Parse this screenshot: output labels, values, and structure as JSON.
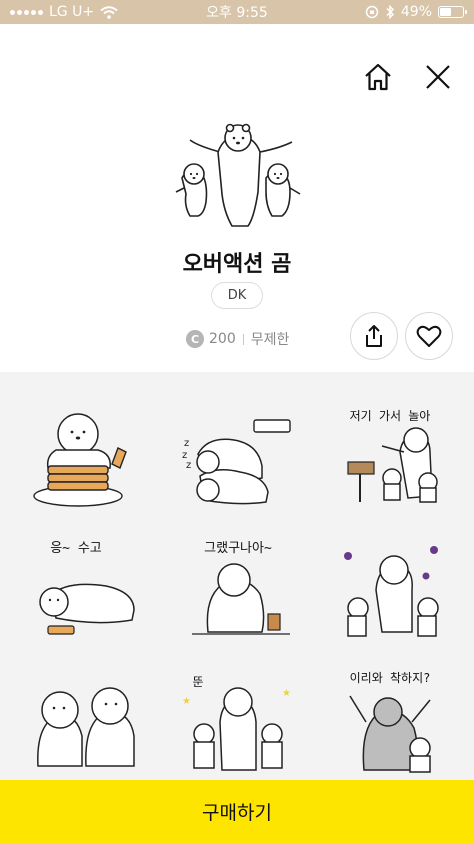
{
  "status_bar": {
    "carrier": "LG U+",
    "time": "오후 9:55",
    "battery_text": "49%",
    "battery_level": 0.49
  },
  "header": {
    "home_icon": "home-icon",
    "close_icon": "close-icon"
  },
  "product": {
    "title": "오버액션 곰",
    "author": "DK",
    "coin_symbol": "C",
    "price": "200",
    "duration": "무제한"
  },
  "actions": {
    "share_icon": "share-icon",
    "like_icon": "heart-icon"
  },
  "stickers": [
    {
      "caption": ""
    },
    {
      "caption": ""
    },
    {
      "caption": "저기 가서 놀아"
    },
    {
      "caption": "응~ 수고"
    },
    {
      "caption": "그랬구나아~"
    },
    {
      "caption": ""
    },
    {
      "caption": ""
    },
    {
      "caption": "뚠"
    },
    {
      "caption": "이리와 착하지?"
    }
  ],
  "buy_button": {
    "label": "구매하기"
  },
  "colors": {
    "accent": "#fee500",
    "status_bar": "#d8c4a8",
    "grid_background": "#f3f3f3",
    "coin": "#b5b5b5"
  }
}
